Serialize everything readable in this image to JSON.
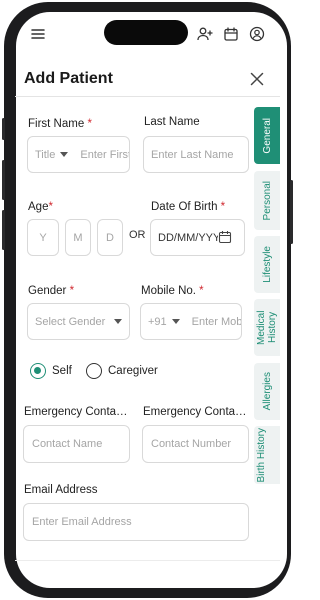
{
  "header": {
    "title": "Add Patient"
  },
  "form": {
    "first_name": {
      "label": "First Name",
      "required": "*",
      "title_placeholder": "Title",
      "placeholder": "Enter First Name"
    },
    "last_name": {
      "label": "Last Name",
      "placeholder": "Enter Last Name"
    },
    "age": {
      "label": "Age",
      "required": "*",
      "year_placeholder": "Y",
      "month_placeholder": "M",
      "day_placeholder": "D"
    },
    "or_text": "OR",
    "dob": {
      "label": "Date Of Birth",
      "required": "*",
      "placeholder": "DD/MM/YYYY"
    },
    "gender": {
      "label": "Gender",
      "required": "*",
      "placeholder": "Select Gender"
    },
    "mobile": {
      "label": "Mobile No.",
      "required": "*",
      "code": "+91",
      "placeholder": "Enter Mobile No."
    },
    "relation": {
      "self_label": "Self",
      "caregiver_label": "Caregiver",
      "selected": "Self"
    },
    "emergency_name": {
      "label": "Emergency Contact Name",
      "placeholder": "Contact Name"
    },
    "emergency_number": {
      "label": "Emergency Contact Number",
      "placeholder": "Contact Number"
    },
    "email": {
      "label": "Email Address",
      "placeholder": "Enter Email Address"
    }
  },
  "tabs": [
    {
      "label": "General",
      "active": true
    },
    {
      "label": "Personal",
      "active": false
    },
    {
      "label": "Lifestyle",
      "active": false
    },
    {
      "label": "Medical History",
      "active": false
    },
    {
      "label": "Allergies",
      "active": false
    },
    {
      "label": "Birth History",
      "active": false
    }
  ],
  "icons": {
    "menu": "hamburger-menu-icon",
    "add_user": "add-user-icon",
    "calendar": "calendar-icon",
    "profile": "profile-icon",
    "close": "close-icon",
    "dob_calendar": "calendar-icon"
  },
  "colors": {
    "accent": "#1f8f76",
    "required": "#d0282f",
    "tab_inactive_bg": "#eef2f2"
  }
}
